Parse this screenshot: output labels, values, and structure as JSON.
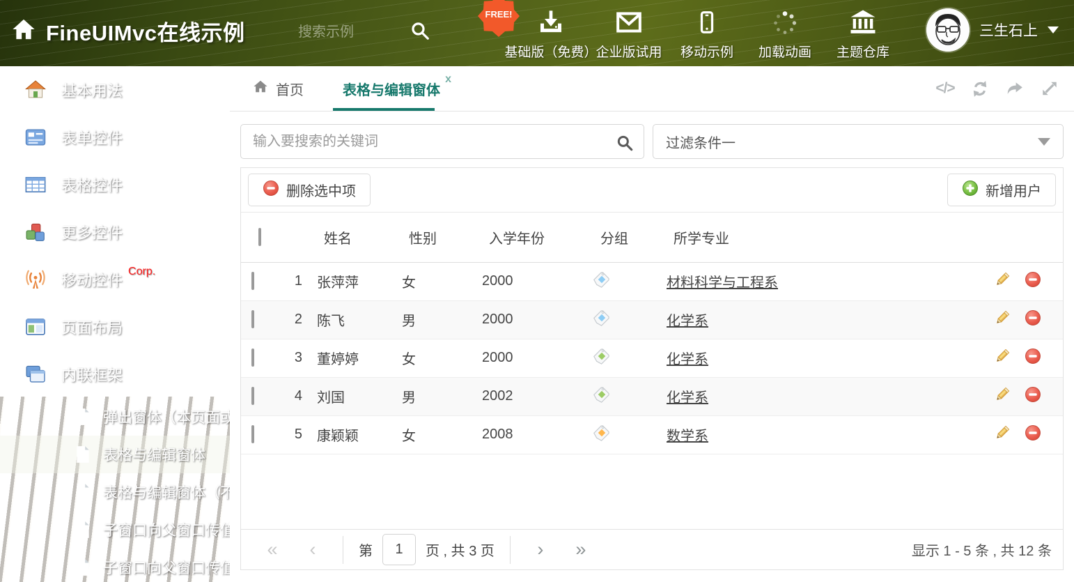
{
  "colors": {
    "accent_teal": "#17796c",
    "badge_orange": "#f2592a",
    "delete_red": "#e05045",
    "add_green": "#6cbf44",
    "tag_blue": "#8ecdf5",
    "tag_green": "#9ccc65",
    "tag_orange": "#ffb74d"
  },
  "header": {
    "title": "FineUIMvc在线示例",
    "search_placeholder": "搜索示例",
    "free_badge": "FREE!",
    "nav_items": [
      {
        "label": "基础版（免费）",
        "icon": "download-icon"
      },
      {
        "label": "企业版试用",
        "icon": "envelope-icon"
      },
      {
        "label": "移动示例",
        "icon": "mobile-icon"
      },
      {
        "label": "加载动画",
        "icon": "spinner-icon"
      },
      {
        "label": "主题仓库",
        "icon": "bank-icon"
      }
    ],
    "user": {
      "name": "三生石上"
    }
  },
  "sidebar": {
    "items": [
      {
        "label": "基本用法",
        "icon": "home-icon"
      },
      {
        "label": "表单控件",
        "icon": "form-icon"
      },
      {
        "label": "表格控件",
        "icon": "table-icon"
      },
      {
        "label": "更多控件",
        "icon": "cubes-icon"
      },
      {
        "label": "移动控件",
        "corp": "Corp.",
        "icon": "antenna-icon"
      },
      {
        "label": "页面布局",
        "icon": "layout-icon"
      },
      {
        "label": "内联框架",
        "icon": "frames-icon",
        "expanded": true
      }
    ],
    "subitems": [
      {
        "label": "弹出窗体（本页面或..."
      },
      {
        "label": "表格与编辑窗体",
        "selected": true
      },
      {
        "label": "表格与编辑窗体（不..."
      },
      {
        "label": "子窗口向父窗口传值"
      },
      {
        "label": "子窗口向父窗口传值..."
      }
    ]
  },
  "tabs": {
    "home": "首页",
    "active": "表格与编辑窗体",
    "close_glyph": "x",
    "tools": {
      "code_glyph": "</>"
    }
  },
  "search": {
    "placeholder": "输入要搜索的关键词"
  },
  "filter": {
    "value": "过滤条件一"
  },
  "toolbar": {
    "delete_label": "删除选中项",
    "add_label": "新增用户"
  },
  "table": {
    "headers": {
      "name": "姓名",
      "gender": "性别",
      "year": "入学年份",
      "group": "分组",
      "major": "所学专业"
    },
    "rows": [
      {
        "num": "1",
        "name": "张萍萍",
        "gender": "女",
        "year": "2000",
        "tag": "blue",
        "tag_hex": "#8ecdf5",
        "major": "材料科学与工程系"
      },
      {
        "num": "2",
        "name": "陈飞",
        "gender": "男",
        "year": "2000",
        "tag": "blue",
        "tag_hex": "#8ecdf5",
        "major": "化学系"
      },
      {
        "num": "3",
        "name": "董婷婷",
        "gender": "女",
        "year": "2000",
        "tag": "green",
        "tag_hex": "#9ccc65",
        "major": "化学系"
      },
      {
        "num": "4",
        "name": "刘国",
        "gender": "男",
        "year": "2002",
        "tag": "green",
        "tag_hex": "#9ccc65",
        "major": "化学系"
      },
      {
        "num": "5",
        "name": "康颖颖",
        "gender": "女",
        "year": "2008",
        "tag": "orange",
        "tag_hex": "#ffb74d",
        "major": "数学系"
      }
    ]
  },
  "pagination": {
    "first_glyph": "«",
    "prev_glyph": "‹",
    "page_prefix": "第",
    "current_page": "1",
    "page_suffix": "页 , 共 3 页",
    "next_glyph": "›",
    "last_glyph": "»",
    "summary": "显示 1 - 5 条 , 共 12 条"
  }
}
